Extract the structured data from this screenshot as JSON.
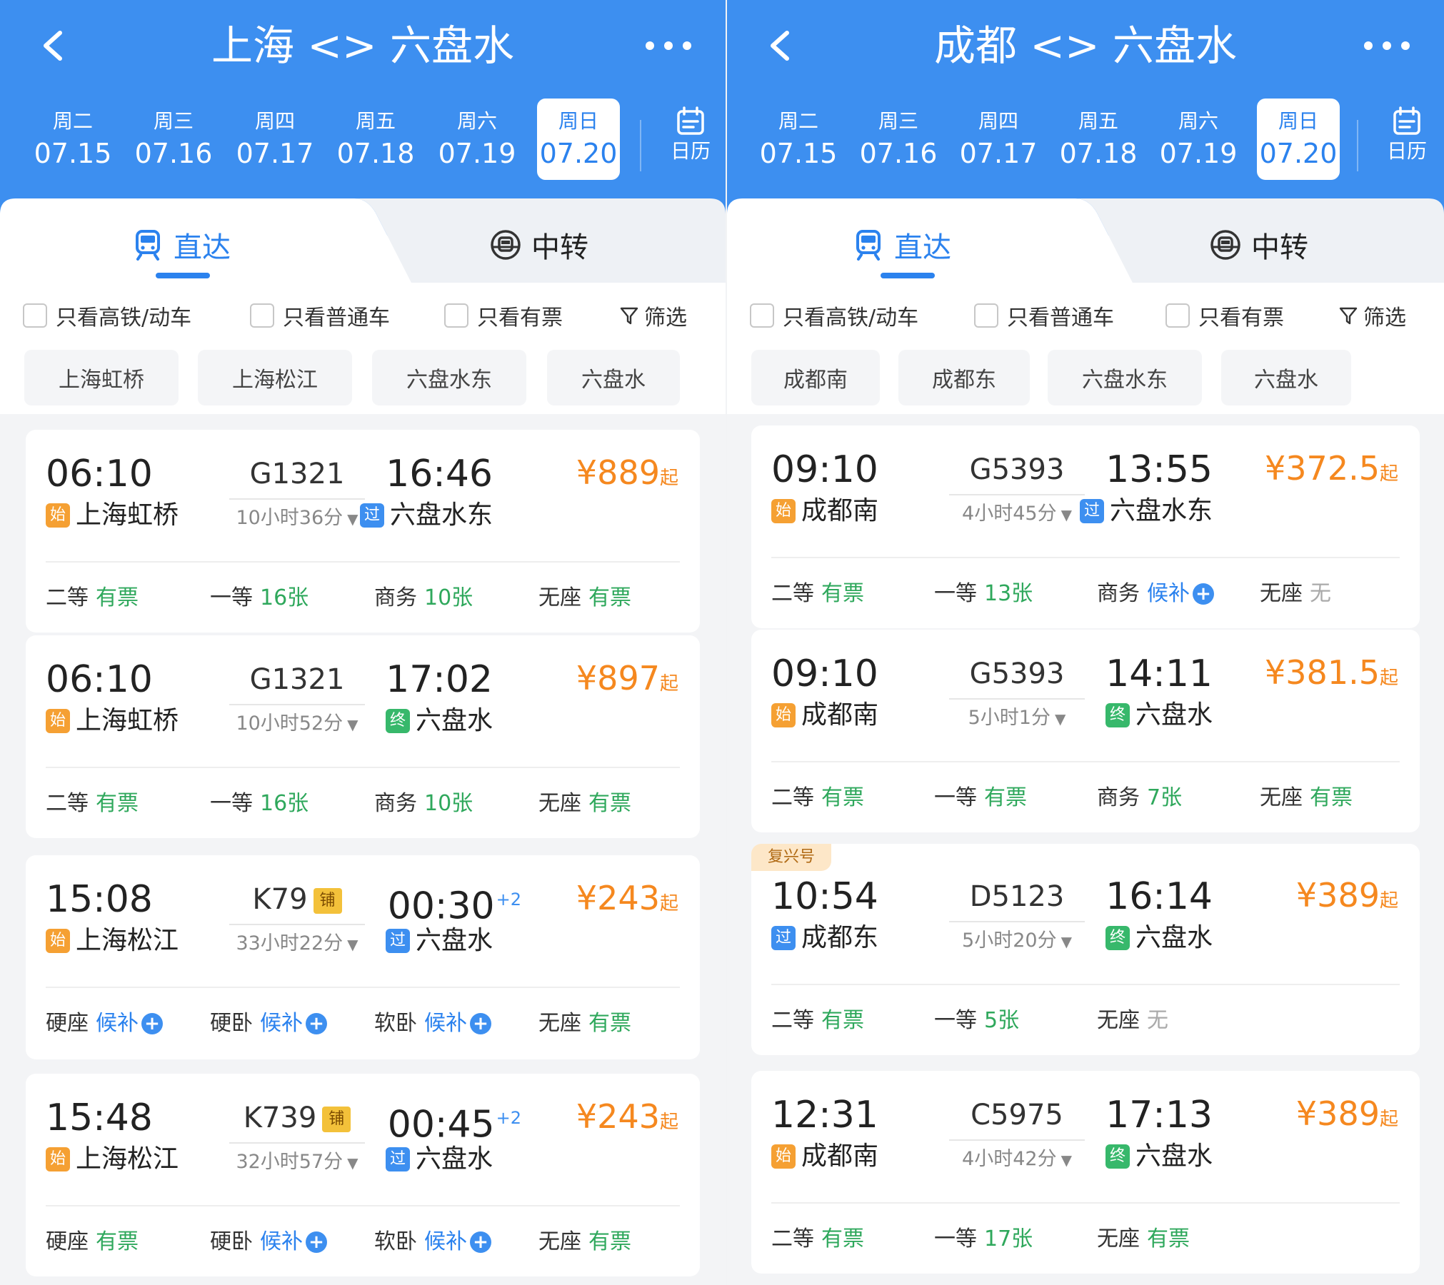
{
  "panels": [
    {
      "title": "上海 <> 六盘水",
      "dates": [
        {
          "weekday": "周二",
          "date": "07.15"
        },
        {
          "weekday": "周三",
          "date": "07.16"
        },
        {
          "weekday": "周四",
          "date": "07.17"
        },
        {
          "weekday": "周五",
          "date": "07.18"
        },
        {
          "weekday": "周六",
          "date": "07.19"
        },
        {
          "weekday": "周日",
          "date": "07.20",
          "selected": true
        }
      ],
      "calendar_label": "日历",
      "tabs": {
        "direct": "直达",
        "transfer": "中转"
      },
      "filters": {
        "high_speed": "只看高铁/动车",
        "normal": "只看普通车",
        "available": "只看有票",
        "filter": "筛选"
      },
      "stations": [
        "上海虹桥",
        "上海松江",
        "六盘水东",
        "六盘水"
      ],
      "trains": [
        {
          "dep_time": "06:10",
          "train_no": "G1321",
          "duration": "10小时36分",
          "arr_time": "16:46",
          "day_offset": "",
          "dep_badge": "始",
          "dep_station": "上海虹桥",
          "arr_badge": "过",
          "arr_station": "六盘水东",
          "price": "¥889",
          "price_suffix": "起",
          "berth": "",
          "seats": [
            {
              "type": "二等",
              "status": "有票",
              "color": "green"
            },
            {
              "type": "一等",
              "status": "16张",
              "color": "green"
            },
            {
              "type": "商务",
              "status": "10张",
              "color": "green"
            },
            {
              "type": "无座",
              "status": "有票",
              "color": "green"
            }
          ]
        },
        {
          "dep_time": "06:10",
          "train_no": "G1321",
          "duration": "10小时52分",
          "arr_time": "17:02",
          "day_offset": "",
          "dep_badge": "始",
          "dep_station": "上海虹桥",
          "arr_badge": "终",
          "arr_station": "六盘水",
          "price": "¥897",
          "price_suffix": "起",
          "berth": "",
          "seats": [
            {
              "type": "二等",
              "status": "有票",
              "color": "green"
            },
            {
              "type": "一等",
              "status": "16张",
              "color": "green"
            },
            {
              "type": "商务",
              "status": "10张",
              "color": "green"
            },
            {
              "type": "无座",
              "status": "有票",
              "color": "green"
            }
          ]
        },
        {
          "dep_time": "15:08",
          "train_no": "K79",
          "duration": "33小时22分",
          "arr_time": "00:30",
          "day_offset": "+2",
          "dep_badge": "始",
          "dep_station": "上海松江",
          "arr_badge": "过",
          "arr_station": "六盘水",
          "price": "¥243",
          "price_suffix": "起",
          "berth": "铺",
          "seats": [
            {
              "type": "硬座",
              "status": "候补",
              "color": "blue",
              "plus": true
            },
            {
              "type": "硬卧",
              "status": "候补",
              "color": "blue",
              "plus": true
            },
            {
              "type": "软卧",
              "status": "候补",
              "color": "blue",
              "plus": true
            },
            {
              "type": "无座",
              "status": "有票",
              "color": "green"
            }
          ]
        },
        {
          "dep_time": "15:48",
          "train_no": "K739",
          "duration": "32小时57分",
          "arr_time": "00:45",
          "day_offset": "+2",
          "dep_badge": "始",
          "dep_station": "上海松江",
          "arr_badge": "过",
          "arr_station": "六盘水",
          "price": "¥243",
          "price_suffix": "起",
          "berth": "铺",
          "seats": [
            {
              "type": "硬座",
              "status": "有票",
              "color": "green"
            },
            {
              "type": "硬卧",
              "status": "候补",
              "color": "blue",
              "plus": true
            },
            {
              "type": "软卧",
              "status": "候补",
              "color": "blue",
              "plus": true
            },
            {
              "type": "无座",
              "status": "有票",
              "color": "green"
            }
          ]
        }
      ]
    },
    {
      "title": "成都 <> 六盘水",
      "dates": [
        {
          "weekday": "周二",
          "date": "07.15"
        },
        {
          "weekday": "周三",
          "date": "07.16"
        },
        {
          "weekday": "周四",
          "date": "07.17"
        },
        {
          "weekday": "周五",
          "date": "07.18"
        },
        {
          "weekday": "周六",
          "date": "07.19"
        },
        {
          "weekday": "周日",
          "date": "07.20",
          "selected": true
        }
      ],
      "calendar_label": "日历",
      "tabs": {
        "direct": "直达",
        "transfer": "中转"
      },
      "filters": {
        "high_speed": "只看高铁/动车",
        "normal": "只看普通车",
        "available": "只看有票",
        "filter": "筛选"
      },
      "stations": [
        "成都南",
        "成都东",
        "六盘水东",
        "六盘水"
      ],
      "trains": [
        {
          "dep_time": "09:10",
          "train_no": "G5393",
          "duration": "4小时45分",
          "arr_time": "13:55",
          "day_offset": "",
          "dep_badge": "始",
          "dep_station": "成都南",
          "arr_badge": "过",
          "arr_station": "六盘水东",
          "price": "¥372.5",
          "price_suffix": "起",
          "berth": "",
          "tag": "",
          "seats": [
            {
              "type": "二等",
              "status": "有票",
              "color": "green"
            },
            {
              "type": "一等",
              "status": "13张",
              "color": "green"
            },
            {
              "type": "商务",
              "status": "候补",
              "color": "blue",
              "plus": true
            },
            {
              "type": "无座",
              "status": "无",
              "color": "gray"
            }
          ]
        },
        {
          "dep_time": "09:10",
          "train_no": "G5393",
          "duration": "5小时1分",
          "arr_time": "14:11",
          "day_offset": "",
          "dep_badge": "始",
          "dep_station": "成都南",
          "arr_badge": "终",
          "arr_station": "六盘水",
          "price": "¥381.5",
          "price_suffix": "起",
          "berth": "",
          "tag": "",
          "seats": [
            {
              "type": "二等",
              "status": "有票",
              "color": "green"
            },
            {
              "type": "一等",
              "status": "有票",
              "color": "green"
            },
            {
              "type": "商务",
              "status": "7张",
              "color": "green"
            },
            {
              "type": "无座",
              "status": "有票",
              "color": "green"
            }
          ]
        },
        {
          "dep_time": "10:54",
          "train_no": "D5123",
          "duration": "5小时20分",
          "arr_time": "16:14",
          "day_offset": "",
          "dep_badge": "过",
          "dep_station": "成都东",
          "arr_badge": "终",
          "arr_station": "六盘水",
          "price": "¥389",
          "price_suffix": "起",
          "berth": "",
          "tag": "复兴号",
          "seats": [
            {
              "type": "二等",
              "status": "有票",
              "color": "green"
            },
            {
              "type": "一等",
              "status": "5张",
              "color": "green"
            },
            {
              "type": "无座",
              "status": "无",
              "color": "gray"
            }
          ]
        },
        {
          "dep_time": "12:31",
          "train_no": "C5975",
          "duration": "4小时42分",
          "arr_time": "17:13",
          "day_offset": "",
          "dep_badge": "始",
          "dep_station": "成都南",
          "arr_badge": "终",
          "arr_station": "六盘水",
          "price": "¥389",
          "price_suffix": "起",
          "berth": "",
          "tag": "",
          "seats": [
            {
              "type": "二等",
              "status": "有票",
              "color": "green"
            },
            {
              "type": "一等",
              "status": "17张",
              "color": "green"
            },
            {
              "type": "无座",
              "status": "有票",
              "color": "green"
            }
          ]
        }
      ]
    }
  ],
  "colors": {
    "header": "#3d8ff0",
    "accent": "#2b82ee",
    "price": "#f5881f",
    "available": "#2fa85c"
  }
}
